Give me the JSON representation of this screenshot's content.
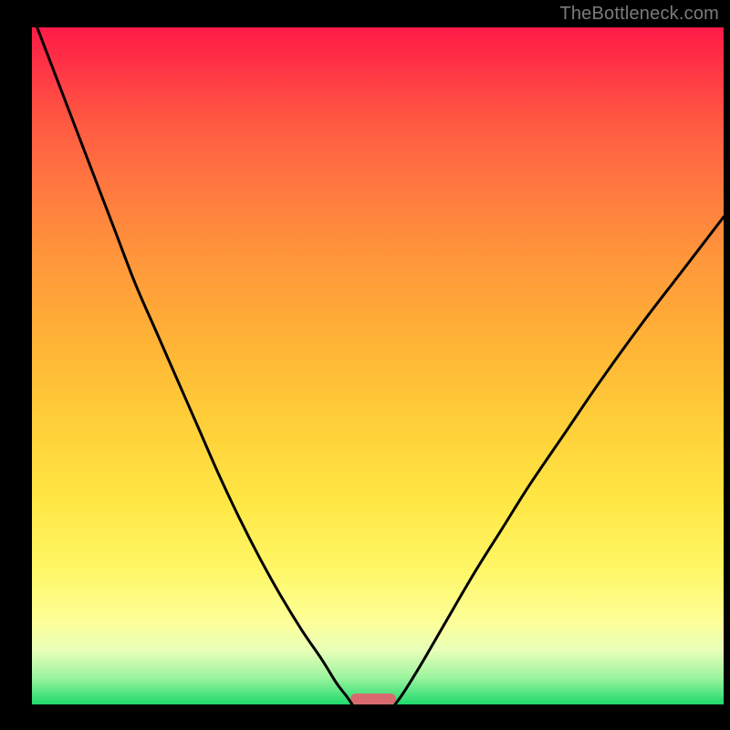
{
  "watermark": "TheBottleneck.com",
  "colors": {
    "frame": "#000000",
    "curve": "#000000",
    "marker": "#d86a6f",
    "gradient_top": "#ff1a47",
    "gradient_bottom": "#1fd96d"
  },
  "chart_data": {
    "type": "line",
    "title": "",
    "xlabel": "",
    "ylabel": "",
    "xlim": [
      0,
      100
    ],
    "ylim": [
      0,
      100
    ],
    "curves": [
      {
        "name": "left-branch",
        "x": [
          0,
          3,
          6,
          9,
          12,
          15,
          18,
          21,
          24,
          27,
          30,
          33,
          36,
          39,
          42,
          44,
          45.5,
          46.3
        ],
        "y": [
          102,
          94,
          86,
          78,
          70,
          62,
          55,
          48,
          41,
          34,
          27.5,
          21.5,
          16,
          11,
          6.5,
          3.2,
          1.2,
          0
        ]
      },
      {
        "name": "right-branch",
        "x": [
          52.5,
          53.5,
          55,
          57,
          60,
          64,
          68,
          72,
          77,
          82,
          88,
          94,
          100
        ],
        "y": [
          0,
          1.4,
          3.8,
          7.2,
          12.5,
          19.5,
          26,
          32.5,
          40,
          47.5,
          56,
          64,
          72
        ]
      }
    ],
    "optimum_marker": {
      "x_center": 49.3,
      "width": 6.6,
      "height_pct": 1.6
    }
  }
}
